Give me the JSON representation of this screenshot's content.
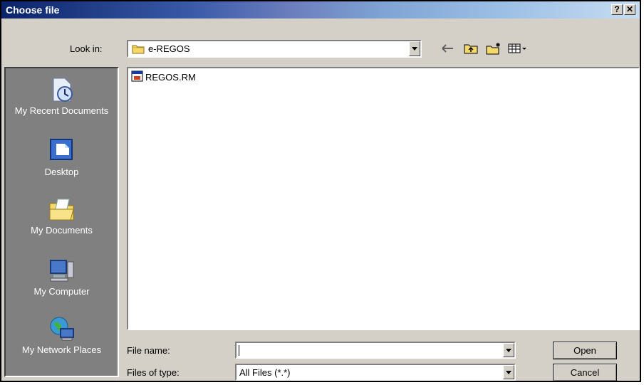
{
  "dialog": {
    "title": "Choose file",
    "help_label": "?",
    "close_label": "✕"
  },
  "toolbar": {
    "look_in_label": "Look in:",
    "look_in_value": "e-REGOS"
  },
  "places": [
    {
      "label": "My Recent Documents",
      "icon": "recent-documents-icon"
    },
    {
      "label": "Desktop",
      "icon": "desktop-icon"
    },
    {
      "label": "My Documents",
      "icon": "my-documents-icon"
    },
    {
      "label": "My Computer",
      "icon": "my-computer-icon"
    },
    {
      "label": "My Network Places",
      "icon": "network-places-icon"
    }
  ],
  "files": [
    {
      "name": "REGOS.RM",
      "icon": "media-file-icon"
    }
  ],
  "bottom": {
    "file_name_label": "File name:",
    "file_name_value": "",
    "file_type_label": "Files of type:",
    "file_type_value": "All Files (*.*)",
    "open_label": "Open",
    "cancel_label": "Cancel"
  }
}
